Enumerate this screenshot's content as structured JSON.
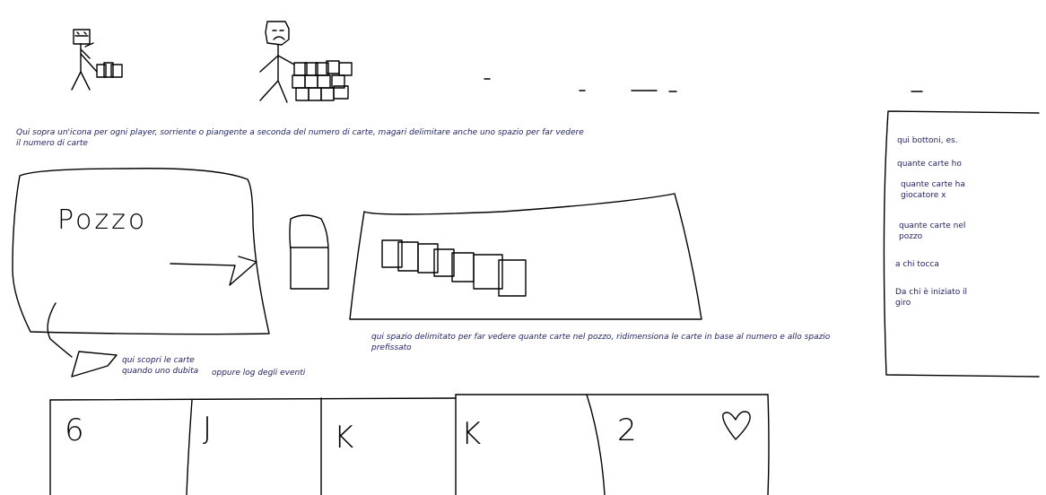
{
  "notes": {
    "players_icons": "Qui sopra un'icona per ogni player, sorriente o piangente a seconda del numero di carte, magari delimitare anche uno spazio per far vedere il numero di carte",
    "discover_cards": "qui scopri le carte\nquando uno dubita",
    "event_log": "oppure log degli eventi",
    "pozzo_space": "qui spazio delimitato per far vedere quante carte nel pozzo, ridimensiona le carte in base al numero e allo spazio prefissato"
  },
  "pozzo": {
    "title": "Pozzo"
  },
  "side_panel": {
    "intro": "qui bottoni, es.",
    "buttons": [
      "quante carte ho",
      "quante carte ha giocatore x",
      "quante carte nel pozzo",
      "a chi tocca",
      "Da chi è iniziato il giro"
    ]
  },
  "hand": {
    "cards": [
      {
        "label": "6"
      },
      {
        "label": "J"
      },
      {
        "label": "K"
      },
      {
        "label": "K"
      },
      {
        "label": "2"
      }
    ],
    "suit_icon": "heart-icon"
  },
  "players": [
    {
      "icon": "player-icon",
      "mood": "happy"
    },
    {
      "icon": "player-icon",
      "mood": "sad"
    }
  ]
}
